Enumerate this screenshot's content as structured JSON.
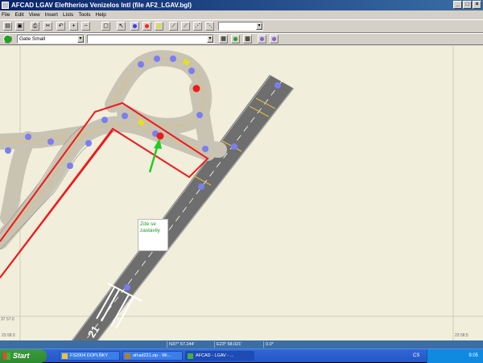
{
  "window": {
    "title": "AFCAD   LGAV   Eleftherios Venizelos Intl    (file AF2_LGAV.bgl)",
    "controls": {
      "minimize": "_",
      "maximize": "□",
      "close": "×"
    }
  },
  "menu": [
    "File",
    "Edit",
    "View",
    "Insert",
    "Lists",
    "Tools",
    "Help"
  ],
  "toolbar2": {
    "parking_type": "Gate Small",
    "second_combo": ""
  },
  "map": {
    "coord_lat": "37 57.0",
    "coord_lon_left": "23 58.0",
    "coord_lon_right": "23 58.5",
    "annotation_line1": "Zde se",
    "annotation_line2": "zastavily"
  },
  "status": {
    "cell1": "",
    "lat": "N37* 57.244'",
    "lon": "E23* 58.021'",
    "heading": "0.0*"
  },
  "taskbar": {
    "start_label": "Start",
    "tasks": [
      "FS2004 DOPLŇKY",
      "afcad221.zip - Wi...",
      "AFCAD - LGAV - ..."
    ],
    "lang": "CS",
    "clock": "9:05"
  },
  "colors": {
    "map_bg": "#f1eedc",
    "taxiway": "#c8c3b3",
    "runway": "#6e6e6e",
    "node": "#7a7ef0",
    "hold": "#ee1a1a",
    "highlight": "#ee1a1a",
    "arrow": "#22cc22"
  }
}
